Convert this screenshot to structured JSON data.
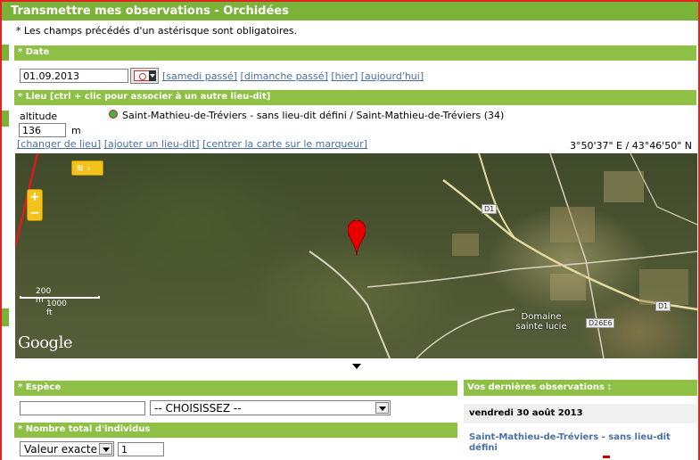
{
  "window": {
    "title": "Transmettre mes observations - Orchidées"
  },
  "required_note": "* Les champs précédés d'un astérisque sont obligatoires.",
  "sections": {
    "date": "* Date",
    "lieu": "* Lieu [ctrl + clic pour associer à un autre lieu-dit]",
    "espece": "* Espèce",
    "nombre": "* Nombre total d'individus"
  },
  "date": {
    "value": "01.09.2013",
    "links": [
      "[samedi passé]",
      "[dimanche passé]",
      "[hier]",
      "[aujourd'hui]"
    ]
  },
  "lieu": {
    "altitude_label": "altitude",
    "altitude_value": "136",
    "altitude_unit": "m",
    "location_text": "Saint-Mathieu-de-Tréviers - sans lieu-dit défini / Saint-Mathieu-de-Tréviers (34)",
    "links": [
      "[changer de lieu]",
      "[ajouter un lieu-dit]",
      "[centrer la carte sur le marqueur]"
    ],
    "coordinates": "3°50'37\" E / 43°46'50\" N"
  },
  "map": {
    "scale_m": "200 m",
    "scale_ft": "1000 ft",
    "brand": "Google",
    "road_d1": "D1",
    "road_d26e6": "D26E6",
    "place": "Domaine sainte lucie",
    "layers_icon": "layers-icon",
    "zoom_in": "+",
    "zoom_out": "−"
  },
  "espece": {
    "input_value": "",
    "select_value": "-- CHOISISSEZ --"
  },
  "nombre": {
    "select_value": "Valeur exacte",
    "count_value": "1"
  },
  "recent": {
    "title": "Vos dernières observations :",
    "date": "vendredi 30 août 2013",
    "place": "Saint-Mathieu-de-Tréviers - sans lieu-dit défini"
  },
  "colors": {
    "accent": "#8dc044",
    "title_bar": "#7bb33a",
    "link": "#4a6fa5",
    "frame": "#e32222"
  }
}
